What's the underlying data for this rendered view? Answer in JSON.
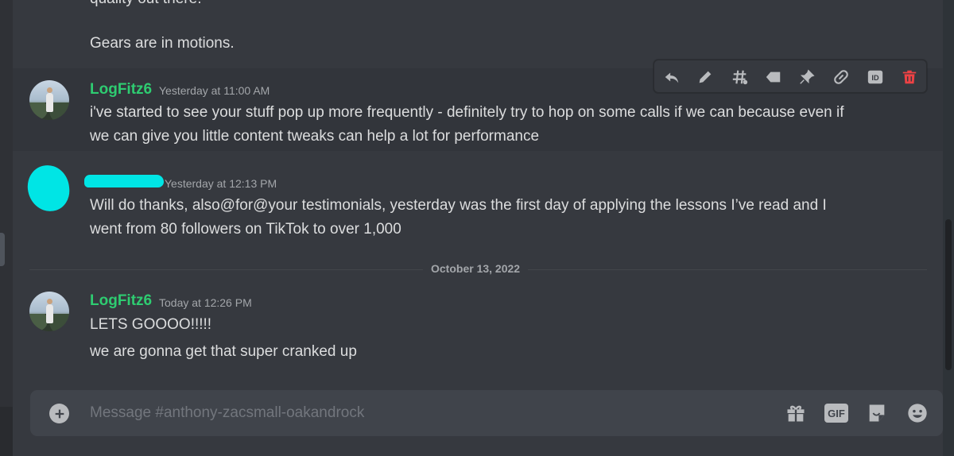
{
  "channel": {
    "cut_text": "quality out there.",
    "first_text": "Gears are in motions."
  },
  "messages": [
    {
      "author": "LogFitz6",
      "time": "Yesterday at 11:00 AM",
      "lines": [
        "i've started to see your stuff pop up more frequently - definitely try to hop on some calls if we can because even if",
        "we can give you little content tweaks can help a lot for performance"
      ]
    },
    {
      "author": "",
      "time": "Yesterday at 12:13 PM",
      "lines": [
        "Will do thanks, also@for@your testimonials, yesterday was the first day of applying the lessons I’ve read and I",
        "went from 80 followers on TikTok to over 1,000"
      ]
    },
    {
      "author": "LogFitz6",
      "time": "Today at 12:26 PM",
      "lines": [
        "LETS GOOOO!!!!!",
        "we are gonna get that super cranked up"
      ]
    }
  ],
  "date_divider": "October 13, 2022",
  "toolbar": {
    "icons": [
      "reply-icon",
      "edit-icon",
      "create-thread-icon",
      "mark-unread-icon",
      "pin-icon",
      "copy-link-icon",
      "copy-id-icon",
      "delete-icon"
    ],
    "id_label": "ID",
    "delete_color": "#ed4245"
  },
  "composer": {
    "placeholder": "Message #anthony-zacsmall-oakandrock",
    "gif_label": "GIF",
    "icons": [
      "add-icon",
      "gift-icon",
      "gif-icon",
      "sticker-icon",
      "emoji-icon"
    ]
  },
  "colors": {
    "username": "#2ecc71",
    "redaction": "#00e5e5",
    "background": "#36393f"
  }
}
